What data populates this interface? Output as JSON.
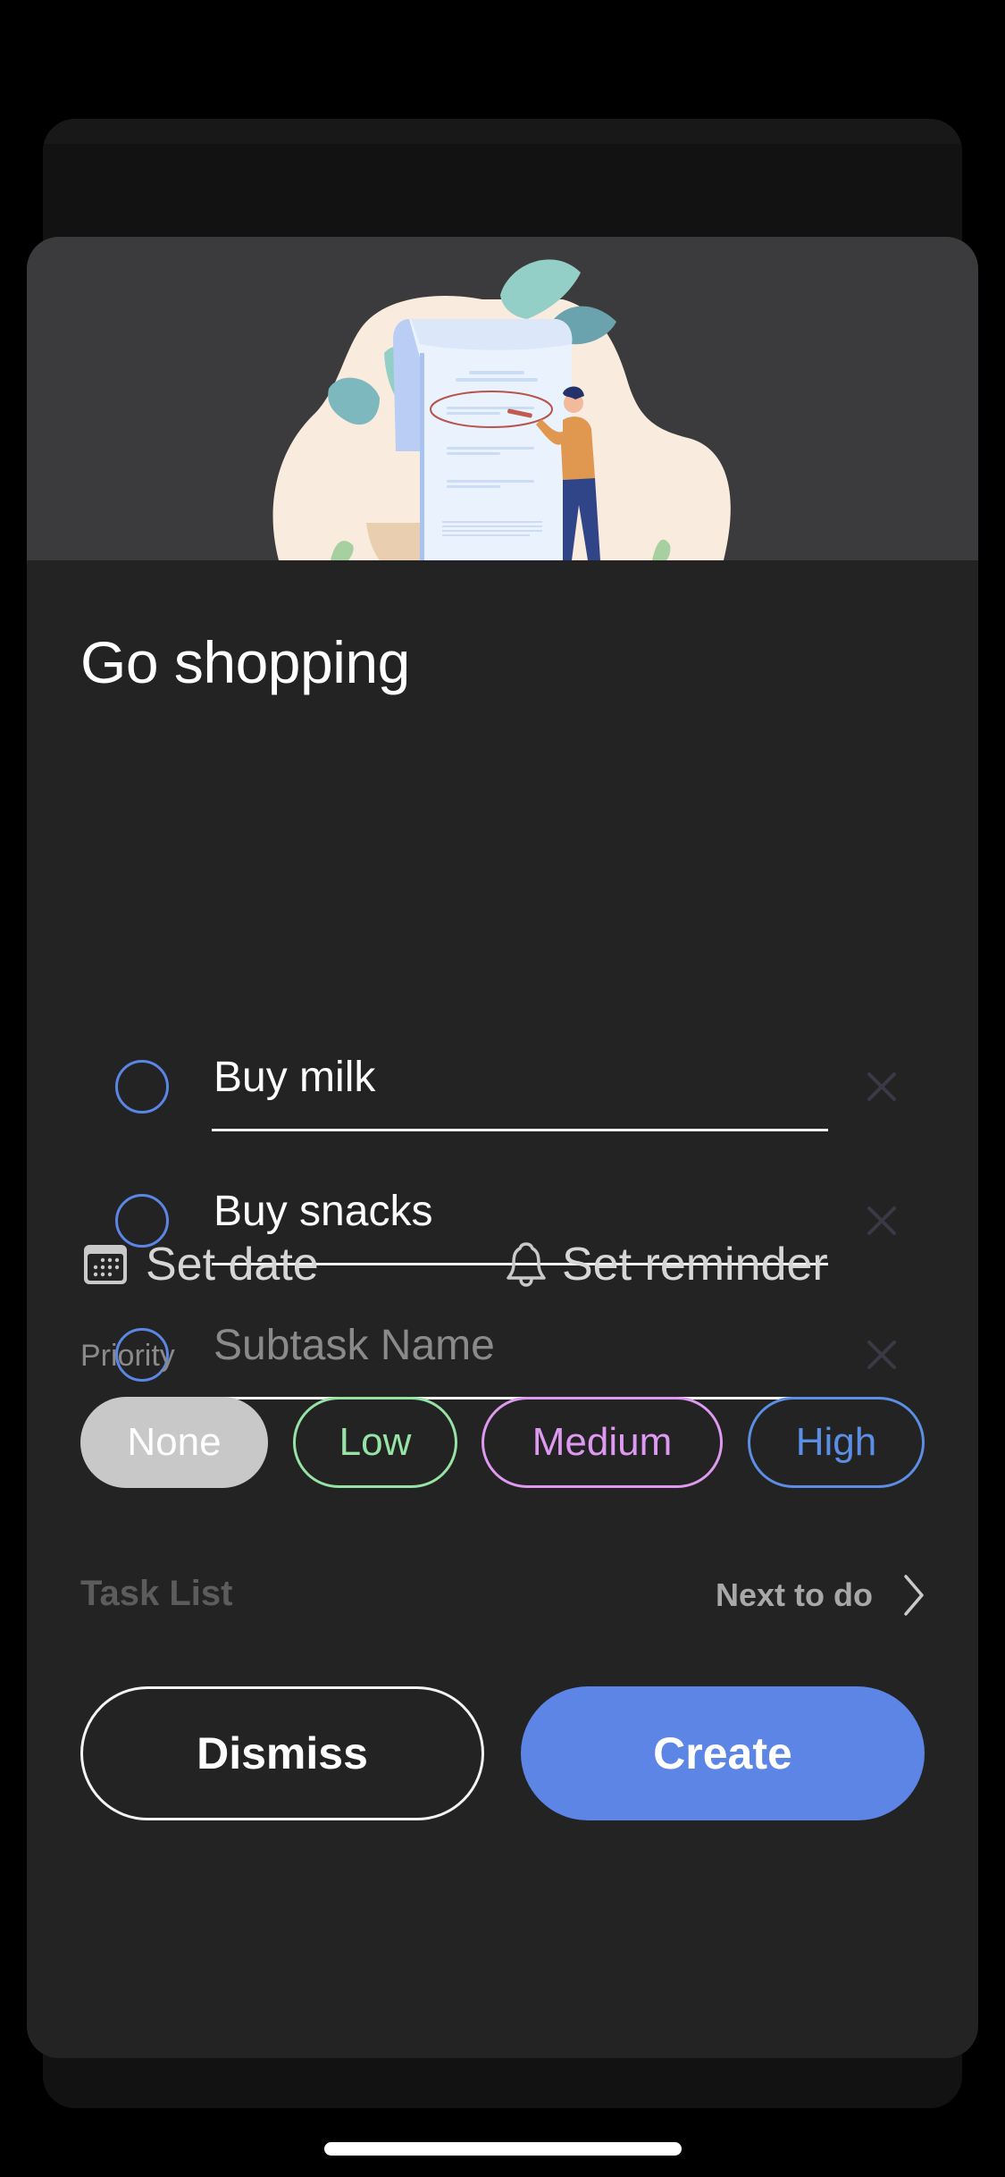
{
  "task": {
    "title": "Go shopping"
  },
  "subtasks": [
    {
      "value": "Buy milk",
      "placeholder": "Subtask Name",
      "completed": false
    },
    {
      "value": "Buy snacks",
      "placeholder": "Subtask Name",
      "completed": false
    },
    {
      "value": "",
      "placeholder": "Subtask Name",
      "completed": false
    }
  ],
  "icons": {
    "checkbox": "circle-outline-icon",
    "delete": "close-icon",
    "date": "calendar-icon",
    "reminder": "bell-icon",
    "chevron": "chevron-right-icon",
    "hero": "checklist-illustration"
  },
  "actions_row": {
    "set_date_label": "Set date",
    "set_reminder_label": "Set reminder"
  },
  "priority": {
    "label": "Priority",
    "selected": "None",
    "options": [
      {
        "label": "None",
        "color": "#c8c8c8"
      },
      {
        "label": "Low",
        "color": "#97e3a6"
      },
      {
        "label": "Medium",
        "color": "#de9af0"
      },
      {
        "label": "High",
        "color": "#5b8fe6"
      }
    ]
  },
  "task_list": {
    "label": "Task List",
    "value": "Next to do"
  },
  "buttons": {
    "dismiss_label": "Dismiss",
    "create_label": "Create"
  },
  "colors": {
    "accent": "#5c85e6",
    "checkbox": "#5b86e5",
    "sheet_bg": "#232323",
    "hero_bg": "#3b3b3d"
  }
}
